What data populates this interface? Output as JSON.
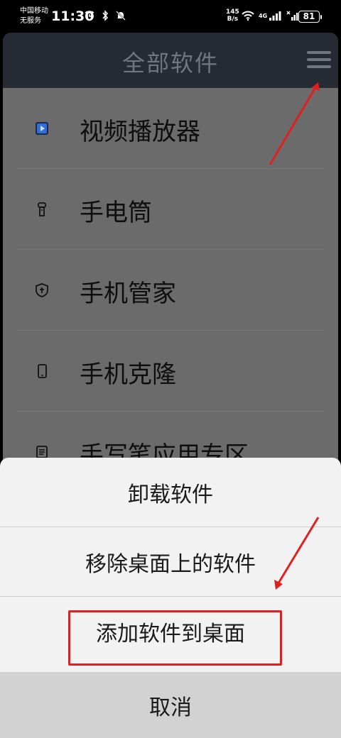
{
  "status_bar": {
    "carrier_line1": "中国移动",
    "carrier_line2": "无服务",
    "time": "11:30",
    "net_speed_value": "145",
    "net_speed_unit": "B/s",
    "network_type": "4G",
    "battery": "81"
  },
  "header": {
    "title": "全部软件",
    "menu_icon": "hamburger-menu-icon"
  },
  "software_list": [
    {
      "label": "视频播放器",
      "icon": "video-player-icon"
    },
    {
      "label": "手电筒",
      "icon": "flashlight-icon"
    },
    {
      "label": "手机管家",
      "icon": "shield-icon"
    },
    {
      "label": "手机克隆",
      "icon": "phone-icon"
    },
    {
      "label": "手写笔应用专区",
      "icon": "notes-icon"
    }
  ],
  "action_sheet": {
    "uninstall": "卸载软件",
    "remove_from_desktop": "移除桌面上的软件",
    "add_to_desktop": "添加软件到桌面",
    "cancel": "取消"
  },
  "annotation_color": "#e02020"
}
